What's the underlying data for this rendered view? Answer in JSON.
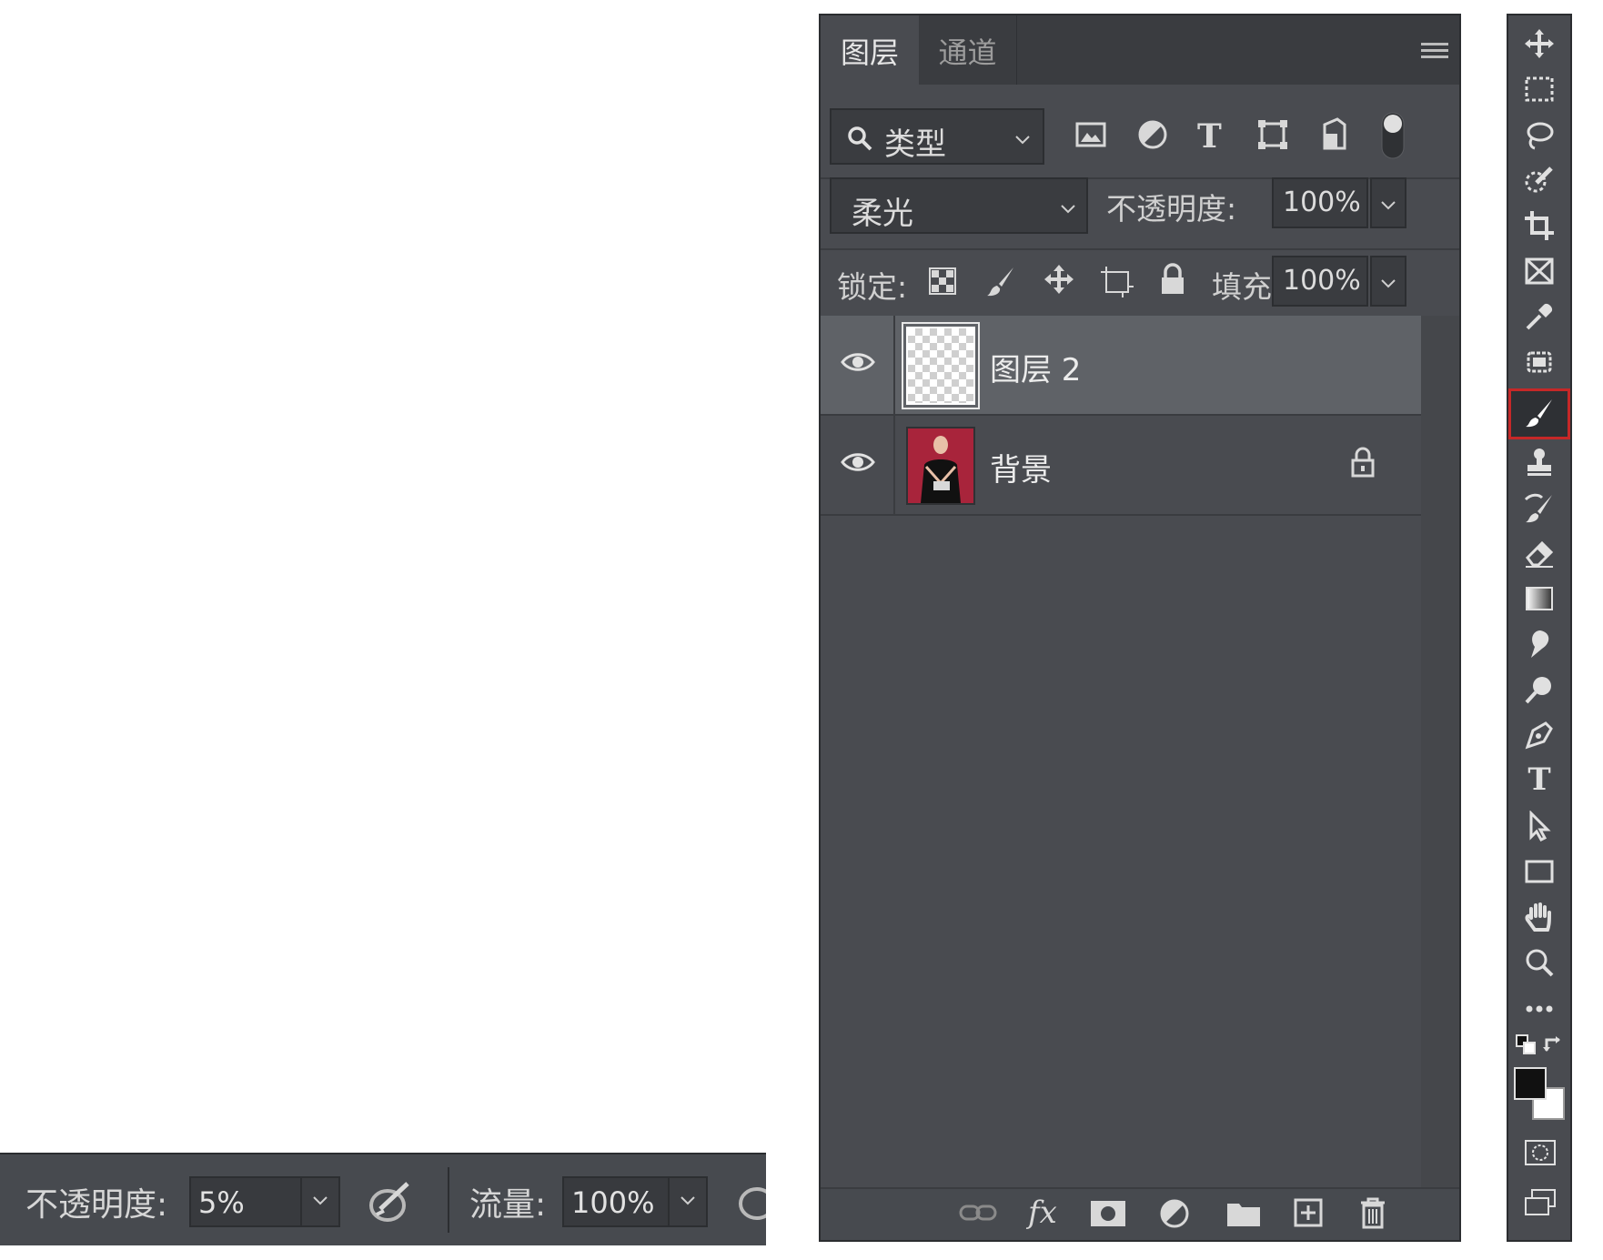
{
  "options_bar": {
    "opacity_label": "不透明度:",
    "opacity_value": "5%",
    "flow_label": "流量:",
    "flow_value": "100%"
  },
  "layers_panel": {
    "tabs": [
      {
        "label": "图层",
        "active": true
      },
      {
        "label": "通道",
        "active": false
      }
    ],
    "filter": {
      "label": "类型"
    },
    "blend_mode": "柔光",
    "opacity_label": "不透明度:",
    "opacity_value": "100%",
    "lock_label": "锁定:",
    "fill_label": "填充:",
    "fill_value": "100%",
    "layers": [
      {
        "name": "图层 2",
        "selected": true,
        "visible": true,
        "locked": false,
        "thumbnail": "transparent-checker"
      },
      {
        "name": "背景",
        "selected": false,
        "visible": true,
        "locked": true,
        "thumbnail": "photo-woman-red-background"
      }
    ],
    "bottom_icons": [
      "link-icon",
      "fx-icon",
      "mask-icon",
      "adjustment-icon",
      "folder-icon",
      "new-layer-icon",
      "trash-icon"
    ]
  },
  "tools_panel": {
    "tools": [
      "move",
      "marquee",
      "lasso",
      "quick-select",
      "crop",
      "frame",
      "eyedropper",
      "patch",
      "brush",
      "stamp",
      "history-brush",
      "eraser",
      "gradient",
      "blur",
      "dodge",
      "pen",
      "type",
      "path-select",
      "rectangle",
      "hand",
      "zoom",
      "more"
    ],
    "selected_tool": "brush",
    "foreground_color": "#111111",
    "background_color": "#ffffff",
    "highlight_color": "#c62828"
  }
}
